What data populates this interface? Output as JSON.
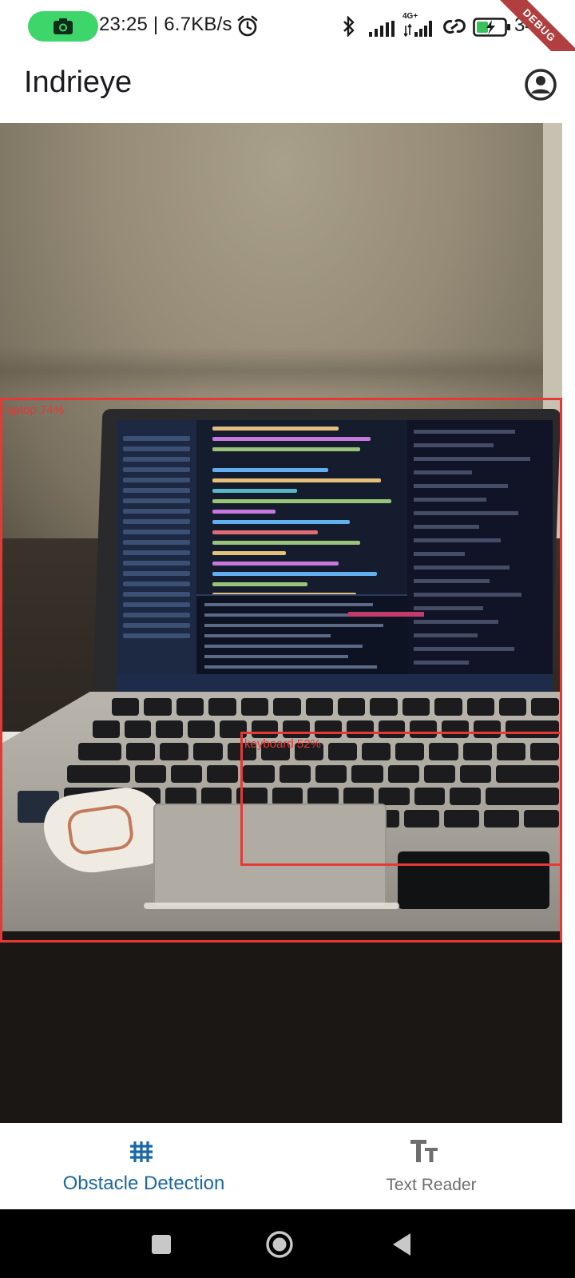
{
  "status_bar": {
    "time_speed": "23:25 | 6.7KB/s",
    "network_type": "4G+",
    "battery_percent": "34",
    "debug_banner": "DEBUG",
    "recording_pill_color": "#3ed66b"
  },
  "app_bar": {
    "title": "Indrieye",
    "account_icon": "account-circle-icon"
  },
  "detections": [
    {
      "label": "laptop 74%"
    },
    {
      "label": "keyboard 52%"
    }
  ],
  "bottom_nav": {
    "items": [
      {
        "label": "Obstacle Detection",
        "icon": "grid-icon",
        "selected": true,
        "color": "#1a67a3"
      },
      {
        "label": "Text Reader",
        "icon": "text-fields-icon",
        "selected": false,
        "color": "#6e6e6e"
      }
    ]
  },
  "system_nav": {
    "buttons": [
      "recents-button",
      "home-button",
      "back-button"
    ]
  },
  "colors": {
    "detection_box": "#e53935",
    "accent": "#1a67a3"
  }
}
